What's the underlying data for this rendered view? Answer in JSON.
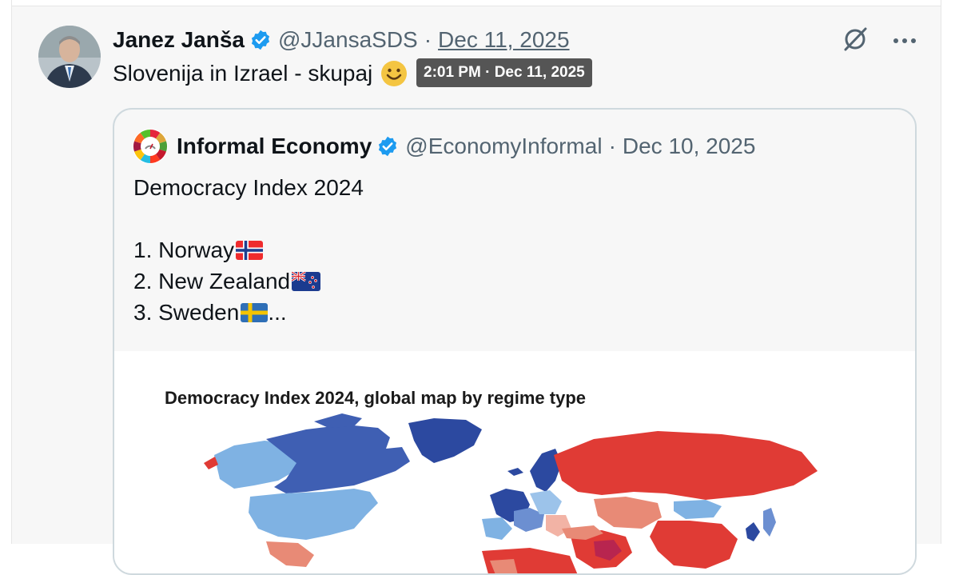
{
  "tweet": {
    "author_name": "Janez Janša",
    "handle": "@JJansaSDS",
    "separator": "·",
    "date": "Dec 11, 2025",
    "text": "Slovenija in Izrael - skupaj",
    "emoji": "smiling-face",
    "tooltip": "2:01 PM · Dec 11, 2025"
  },
  "actions": {
    "grok_icon": "grok-icon",
    "more_icon": "more-icon"
  },
  "quote": {
    "author_name": "Informal Economy",
    "handle": "@EconomyInformal",
    "separator": "·",
    "date": "Dec 10, 2025",
    "title_line": "Democracy Index 2024",
    "items": [
      {
        "text": "1. Norway",
        "flag": "norway-flag"
      },
      {
        "text": "2. New Zealand",
        "flag": "new-zealand-flag"
      },
      {
        "text": "3. Sweden",
        "flag": "sweden-flag",
        "suffix": "..."
      }
    ],
    "media": {
      "title": "Democracy Index 2024, global map by regime type"
    }
  },
  "colors": {
    "verified_blue": "#1d9bf0",
    "secondary_text": "#536471",
    "full_democracy": "#2c49a0",
    "flawed_democracy": "#7fb2e3",
    "hybrid_regime": "#e88a76",
    "authoritarian": "#e03b35"
  }
}
